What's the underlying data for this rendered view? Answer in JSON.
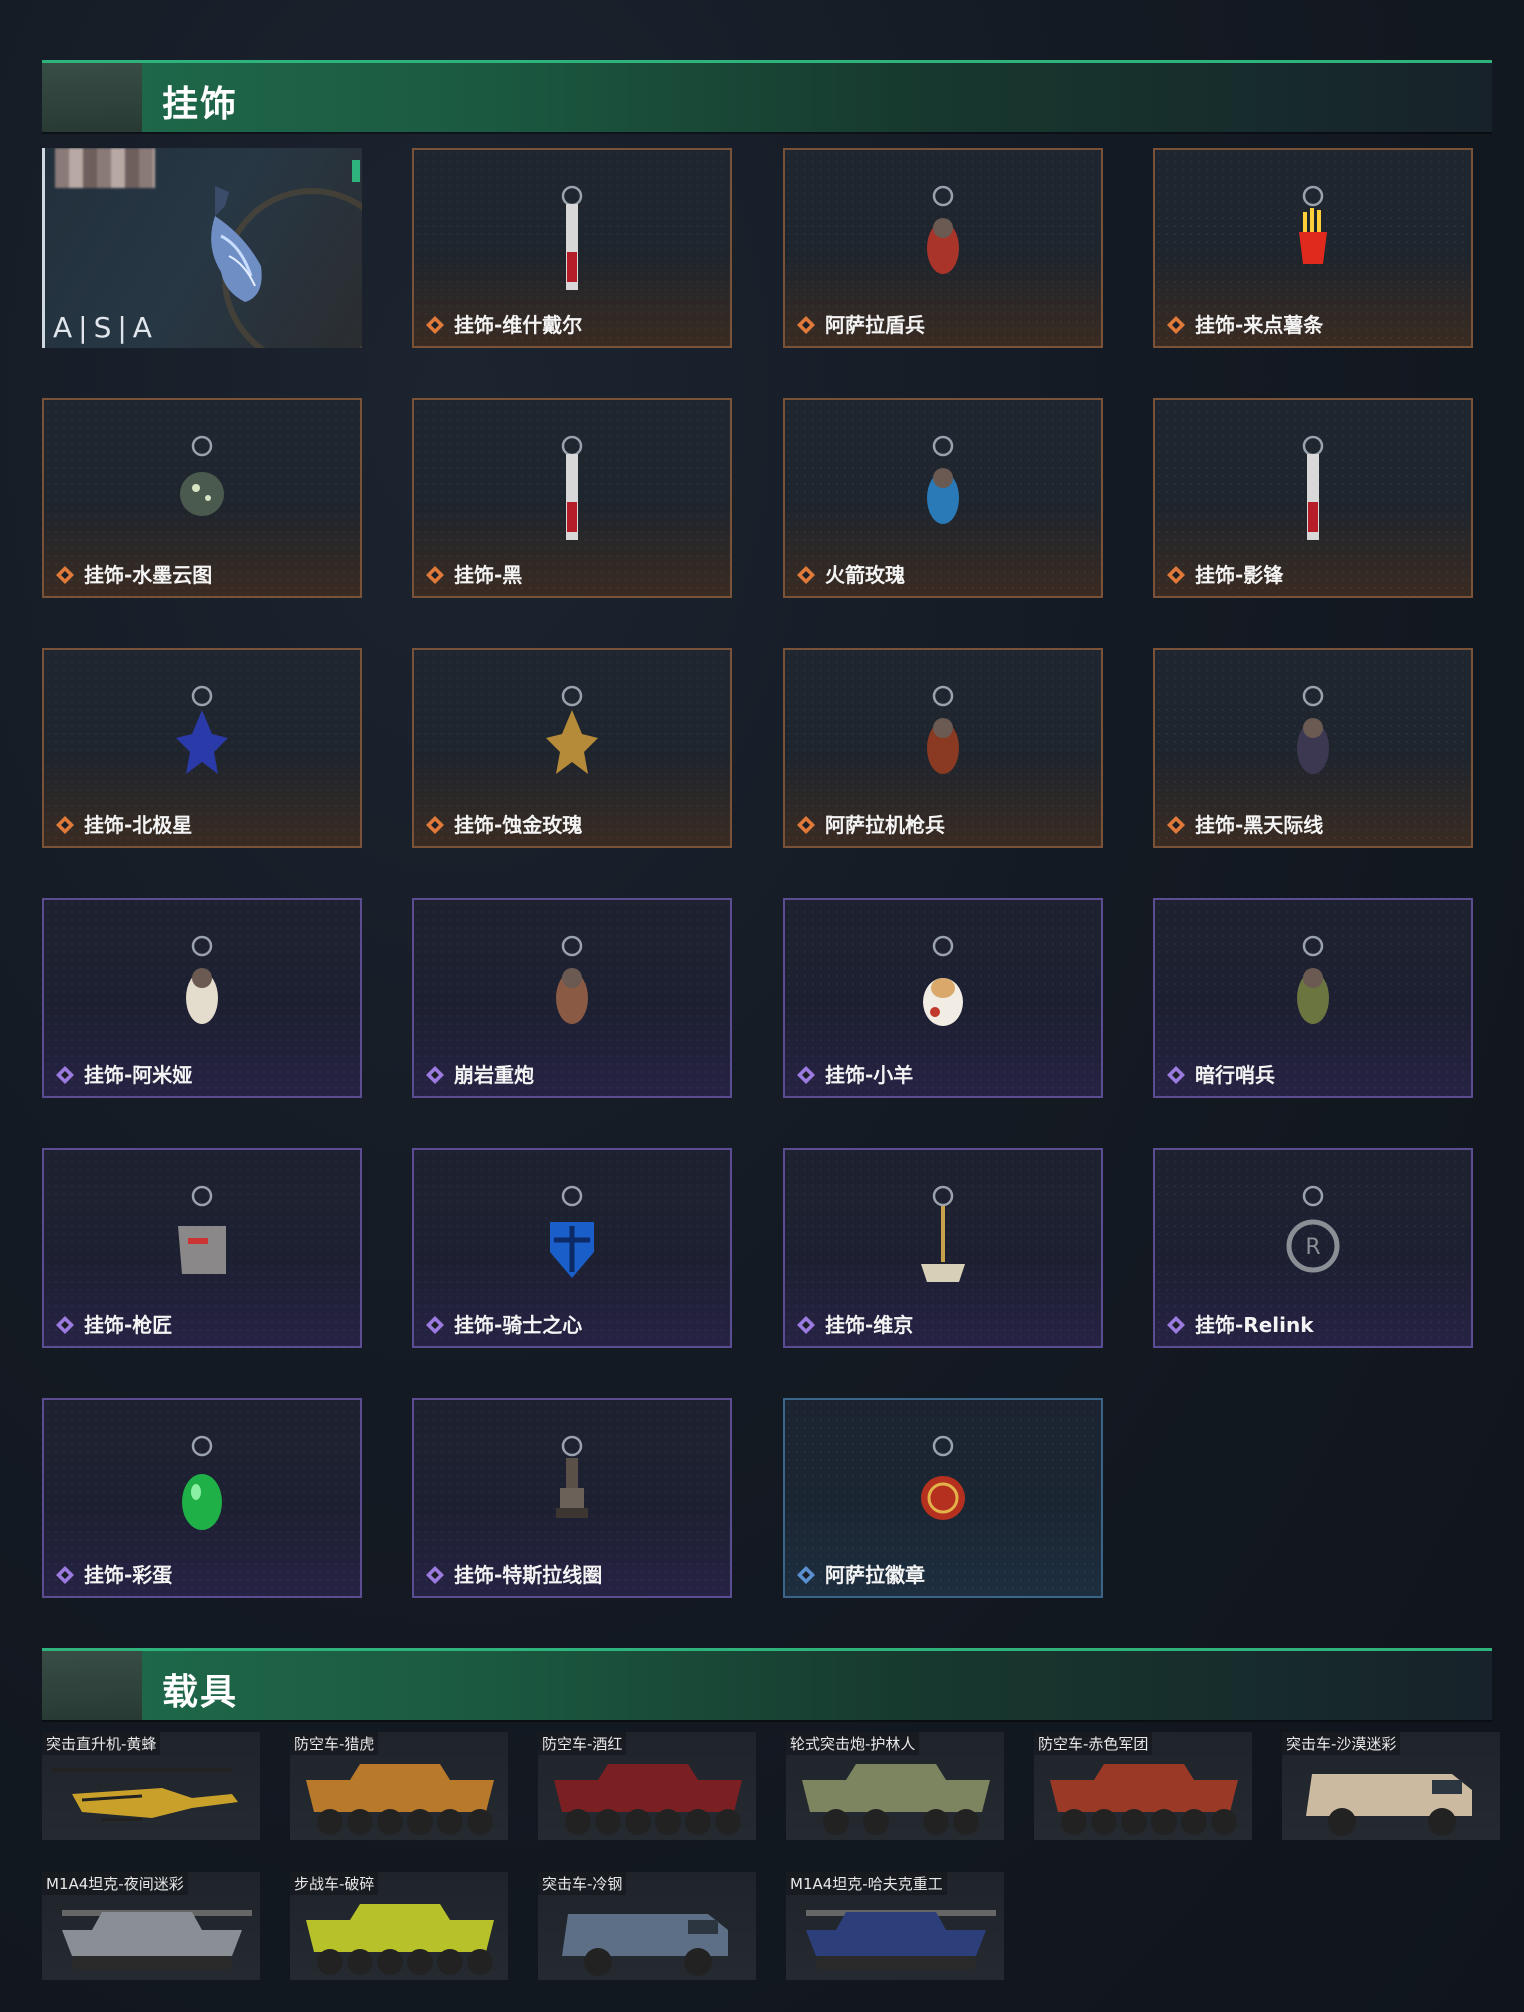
{
  "sections": {
    "ornaments_title": "挂饰",
    "vehicles_title": "载具"
  },
  "feature": {
    "brand": "A|S|A"
  },
  "ornaments": [
    {
      "label": "挂饰-维什戴尔",
      "rarity": "orange",
      "charm": "blade-charm-icon"
    },
    {
      "label": "阿萨拉盾兵",
      "rarity": "orange",
      "charm": "shield-soldier-charm-icon"
    },
    {
      "label": "挂饰-来点薯条",
      "rarity": "orange",
      "charm": "fries-charm-icon"
    },
    {
      "label": "挂饰-水墨云图",
      "rarity": "orange",
      "charm": "sphere-charm-icon"
    },
    {
      "label": "挂饰-黑",
      "rarity": "orange",
      "charm": "blade-charm-icon"
    },
    {
      "label": "火箭玫瑰",
      "rarity": "orange",
      "charm": "rocket-rose-charm-icon"
    },
    {
      "label": "挂饰-影锋",
      "rarity": "orange",
      "charm": "blade-charm-icon"
    },
    {
      "label": "挂饰-北极星",
      "rarity": "orange",
      "charm": "star-charm-icon"
    },
    {
      "label": "挂饰-蚀金玫瑰",
      "rarity": "orange",
      "charm": "gold-rose-charm-icon"
    },
    {
      "label": "阿萨拉机枪兵",
      "rarity": "orange",
      "charm": "gunner-charm-icon"
    },
    {
      "label": "挂饰-黑天际线",
      "rarity": "orange",
      "charm": "figure-charm-icon"
    },
    {
      "label": "挂饰-阿米娅",
      "rarity": "purple",
      "charm": "bunny-charm-icon"
    },
    {
      "label": "崩岩重炮",
      "rarity": "purple",
      "charm": "cannon-charm-icon"
    },
    {
      "label": "挂饰-小羊",
      "rarity": "purple",
      "charm": "sheep-charm-icon"
    },
    {
      "label": "暗行哨兵",
      "rarity": "purple",
      "charm": "sentry-charm-icon"
    },
    {
      "label": "挂饰-枪匠",
      "rarity": "purple",
      "charm": "gunsmith-charm-icon"
    },
    {
      "label": "挂饰-骑士之心",
      "rarity": "purple",
      "charm": "knight-heart-charm-icon"
    },
    {
      "label": "挂饰-维京",
      "rarity": "purple",
      "charm": "hammer-charm-icon"
    },
    {
      "label": "挂饰-Relink",
      "rarity": "purple",
      "charm": "relink-charm-icon"
    },
    {
      "label": "挂饰-彩蛋",
      "rarity": "purple",
      "charm": "egg-charm-icon"
    },
    {
      "label": "挂饰-特斯拉线圈",
      "rarity": "purple",
      "charm": "tesla-coil-charm-icon"
    },
    {
      "label": "阿萨拉徽章",
      "rarity": "blue",
      "charm": "badge-charm-icon"
    }
  ],
  "vehicles": [
    {
      "label": "突击直升机-黄蜂",
      "kind": "helicopter",
      "color": "#c9a12a"
    },
    {
      "label": "防空车-猎虎",
      "kind": "apc",
      "color": "#b8792a"
    },
    {
      "label": "防空车-酒红",
      "kind": "apc",
      "color": "#7a1f22"
    },
    {
      "label": "轮式突击炮-护林人",
      "kind": "apc4",
      "color": "#7d8560"
    },
    {
      "label": "防空车-赤色军团",
      "kind": "apc",
      "color": "#9a3a26"
    },
    {
      "label": "突击车-沙漠迷彩",
      "kind": "truck",
      "color": "#cbb9a0"
    },
    {
      "label": "M1A4坦克-夜间迷彩",
      "kind": "tank",
      "color": "#8a8f96"
    },
    {
      "label": "步战车-破碎",
      "kind": "apc",
      "color": "#b7c22a"
    },
    {
      "label": "突击车-冷钢",
      "kind": "truck",
      "color": "#5d6f86"
    },
    {
      "label": "M1A4坦克-哈夫克重工",
      "kind": "tank",
      "color": "#2c3f7a"
    }
  ],
  "colors": {
    "accent_green": "#2fb37c",
    "rarity_orange": "#e07a3a",
    "rarity_purple": "#9c7be0",
    "rarity_blue": "#5a8fd0"
  }
}
